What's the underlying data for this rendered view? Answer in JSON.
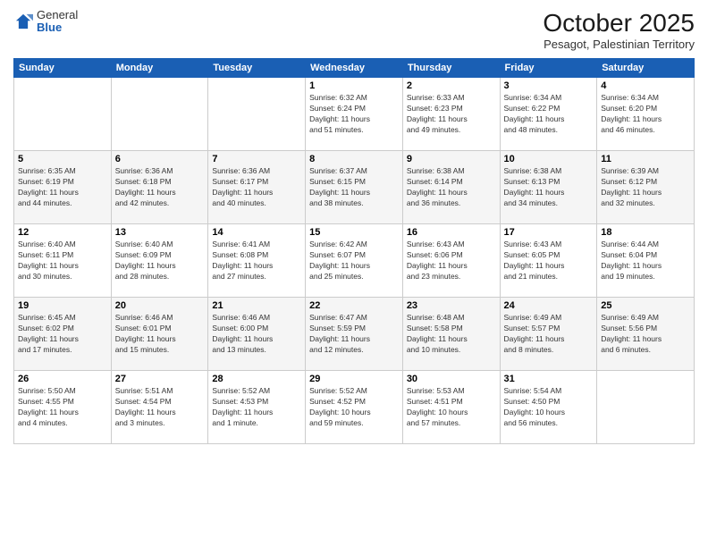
{
  "logo": {
    "general": "General",
    "blue": "Blue"
  },
  "title": "October 2025",
  "location": "Pesagot, Palestinian Territory",
  "days_of_week": [
    "Sunday",
    "Monday",
    "Tuesday",
    "Wednesday",
    "Thursday",
    "Friday",
    "Saturday"
  ],
  "weeks": [
    [
      {
        "day": "",
        "info": ""
      },
      {
        "day": "",
        "info": ""
      },
      {
        "day": "",
        "info": ""
      },
      {
        "day": "1",
        "info": "Sunrise: 6:32 AM\nSunset: 6:24 PM\nDaylight: 11 hours\nand 51 minutes."
      },
      {
        "day": "2",
        "info": "Sunrise: 6:33 AM\nSunset: 6:23 PM\nDaylight: 11 hours\nand 49 minutes."
      },
      {
        "day": "3",
        "info": "Sunrise: 6:34 AM\nSunset: 6:22 PM\nDaylight: 11 hours\nand 48 minutes."
      },
      {
        "day": "4",
        "info": "Sunrise: 6:34 AM\nSunset: 6:20 PM\nDaylight: 11 hours\nand 46 minutes."
      }
    ],
    [
      {
        "day": "5",
        "info": "Sunrise: 6:35 AM\nSunset: 6:19 PM\nDaylight: 11 hours\nand 44 minutes."
      },
      {
        "day": "6",
        "info": "Sunrise: 6:36 AM\nSunset: 6:18 PM\nDaylight: 11 hours\nand 42 minutes."
      },
      {
        "day": "7",
        "info": "Sunrise: 6:36 AM\nSunset: 6:17 PM\nDaylight: 11 hours\nand 40 minutes."
      },
      {
        "day": "8",
        "info": "Sunrise: 6:37 AM\nSunset: 6:15 PM\nDaylight: 11 hours\nand 38 minutes."
      },
      {
        "day": "9",
        "info": "Sunrise: 6:38 AM\nSunset: 6:14 PM\nDaylight: 11 hours\nand 36 minutes."
      },
      {
        "day": "10",
        "info": "Sunrise: 6:38 AM\nSunset: 6:13 PM\nDaylight: 11 hours\nand 34 minutes."
      },
      {
        "day": "11",
        "info": "Sunrise: 6:39 AM\nSunset: 6:12 PM\nDaylight: 11 hours\nand 32 minutes."
      }
    ],
    [
      {
        "day": "12",
        "info": "Sunrise: 6:40 AM\nSunset: 6:11 PM\nDaylight: 11 hours\nand 30 minutes."
      },
      {
        "day": "13",
        "info": "Sunrise: 6:40 AM\nSunset: 6:09 PM\nDaylight: 11 hours\nand 28 minutes."
      },
      {
        "day": "14",
        "info": "Sunrise: 6:41 AM\nSunset: 6:08 PM\nDaylight: 11 hours\nand 27 minutes."
      },
      {
        "day": "15",
        "info": "Sunrise: 6:42 AM\nSunset: 6:07 PM\nDaylight: 11 hours\nand 25 minutes."
      },
      {
        "day": "16",
        "info": "Sunrise: 6:43 AM\nSunset: 6:06 PM\nDaylight: 11 hours\nand 23 minutes."
      },
      {
        "day": "17",
        "info": "Sunrise: 6:43 AM\nSunset: 6:05 PM\nDaylight: 11 hours\nand 21 minutes."
      },
      {
        "day": "18",
        "info": "Sunrise: 6:44 AM\nSunset: 6:04 PM\nDaylight: 11 hours\nand 19 minutes."
      }
    ],
    [
      {
        "day": "19",
        "info": "Sunrise: 6:45 AM\nSunset: 6:02 PM\nDaylight: 11 hours\nand 17 minutes."
      },
      {
        "day": "20",
        "info": "Sunrise: 6:46 AM\nSunset: 6:01 PM\nDaylight: 11 hours\nand 15 minutes."
      },
      {
        "day": "21",
        "info": "Sunrise: 6:46 AM\nSunset: 6:00 PM\nDaylight: 11 hours\nand 13 minutes."
      },
      {
        "day": "22",
        "info": "Sunrise: 6:47 AM\nSunset: 5:59 PM\nDaylight: 11 hours\nand 12 minutes."
      },
      {
        "day": "23",
        "info": "Sunrise: 6:48 AM\nSunset: 5:58 PM\nDaylight: 11 hours\nand 10 minutes."
      },
      {
        "day": "24",
        "info": "Sunrise: 6:49 AM\nSunset: 5:57 PM\nDaylight: 11 hours\nand 8 minutes."
      },
      {
        "day": "25",
        "info": "Sunrise: 6:49 AM\nSunset: 5:56 PM\nDaylight: 11 hours\nand 6 minutes."
      }
    ],
    [
      {
        "day": "26",
        "info": "Sunrise: 5:50 AM\nSunset: 4:55 PM\nDaylight: 11 hours\nand 4 minutes."
      },
      {
        "day": "27",
        "info": "Sunrise: 5:51 AM\nSunset: 4:54 PM\nDaylight: 11 hours\nand 3 minutes."
      },
      {
        "day": "28",
        "info": "Sunrise: 5:52 AM\nSunset: 4:53 PM\nDaylight: 11 hours\nand 1 minute."
      },
      {
        "day": "29",
        "info": "Sunrise: 5:52 AM\nSunset: 4:52 PM\nDaylight: 10 hours\nand 59 minutes."
      },
      {
        "day": "30",
        "info": "Sunrise: 5:53 AM\nSunset: 4:51 PM\nDaylight: 10 hours\nand 57 minutes."
      },
      {
        "day": "31",
        "info": "Sunrise: 5:54 AM\nSunset: 4:50 PM\nDaylight: 10 hours\nand 56 minutes."
      },
      {
        "day": "",
        "info": ""
      }
    ]
  ]
}
